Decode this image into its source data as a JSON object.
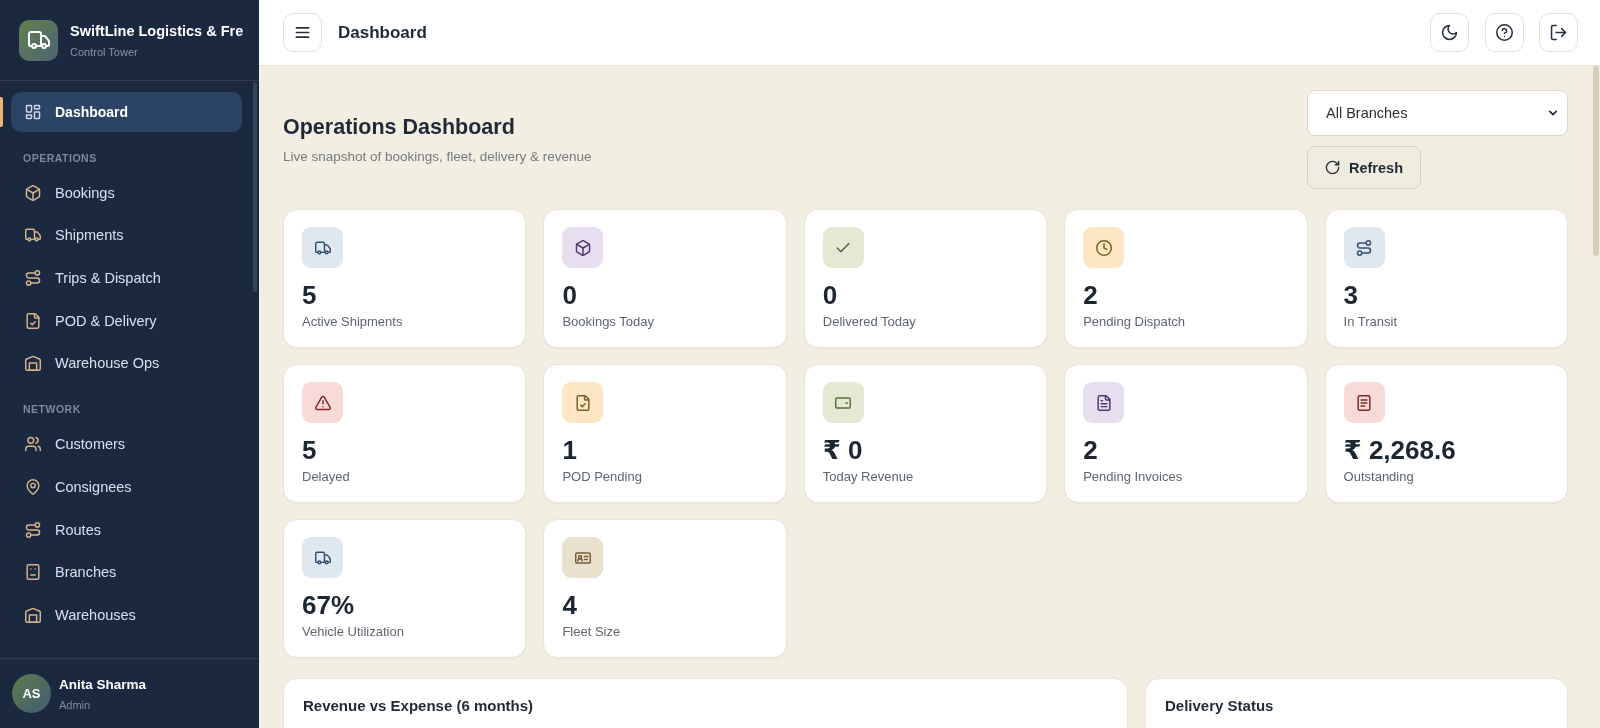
{
  "sidebar": {
    "brand": {
      "name": "SwiftLine Logistics & Fre",
      "subtitle": "Control Tower"
    },
    "items": [
      {
        "label": "Dashboard",
        "selected": true
      }
    ],
    "sections": [
      {
        "title": "OPERATIONS",
        "items": [
          {
            "label": "Bookings",
            "selected": false
          },
          {
            "label": "Shipments",
            "selected": false
          },
          {
            "label": "Trips & Dispatch",
            "selected": false
          },
          {
            "label": "POD & Delivery",
            "selected": false
          },
          {
            "label": "Warehouse Ops",
            "selected": false
          }
        ]
      },
      {
        "title": "NETWORK",
        "items": [
          {
            "label": "Customers",
            "selected": false
          },
          {
            "label": "Consignees",
            "selected": false
          },
          {
            "label": "Routes",
            "selected": false
          },
          {
            "label": "Branches",
            "selected": false
          },
          {
            "label": "Warehouses",
            "selected": false
          }
        ]
      }
    ],
    "user": {
      "initials": "AS",
      "name": "Anita Sharma",
      "role": "Admin"
    }
  },
  "header": {
    "title": "Dashboard"
  },
  "page": {
    "title": "Operations Dashboard",
    "subtitle": "Live snapshot of bookings, fleet, delivery & revenue",
    "branch_select": {
      "value": "All Branches"
    },
    "refresh_button": {
      "label": "Refresh"
    }
  },
  "stats": [
    {
      "value": "5",
      "label": "Active Shipments",
      "color": "#dfe7f0"
    },
    {
      "value": "0",
      "label": "Bookings Today",
      "color": "#e7dff0"
    },
    {
      "value": "0",
      "label": "Delivered Today",
      "color": "#e3e9d3"
    },
    {
      "value": "2",
      "label": "Pending Dispatch",
      "color": "#fce6c3"
    },
    {
      "value": "3",
      "label": "In Transit",
      "color": "#dfe7f0"
    },
    {
      "value": "5",
      "label": "Delayed",
      "color": "#f8dad8"
    },
    {
      "value": "1",
      "label": "POD Pending",
      "color": "#fce6c3"
    },
    {
      "value": "₹ 0",
      "label": "Today Revenue",
      "color": "#e3e9d3"
    },
    {
      "value": "2",
      "label": "Pending Invoices",
      "color": "#e7dff0"
    },
    {
      "value": "₹ 2,268.6",
      "label": "Outstanding",
      "color": "#f8dad8"
    },
    {
      "value": "67%",
      "label": "Vehicle Utilization",
      "color": "#dfe7f0"
    },
    {
      "value": "4",
      "label": "Fleet Size",
      "color": "#e9e0ce"
    }
  ],
  "panels": [
    {
      "title": "Revenue vs Expense (6 months)"
    },
    {
      "title": "Delivery Status"
    }
  ]
}
